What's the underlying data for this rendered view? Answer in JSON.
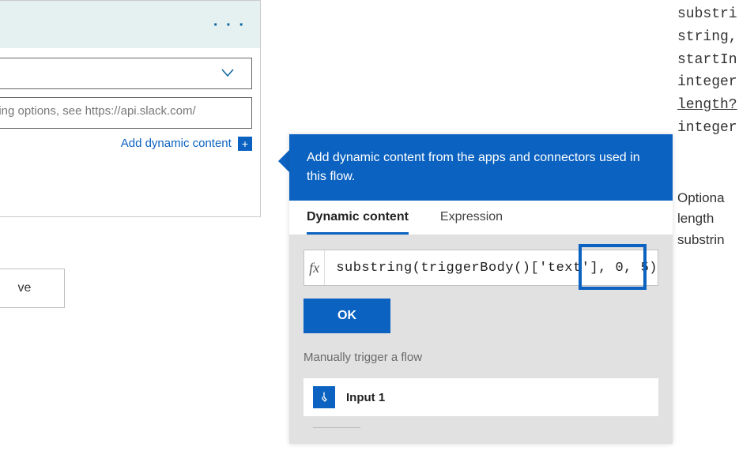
{
  "card": {
    "more_icon": "· · ·",
    "placeholder_text": "tting options, see https://api.slack.com/",
    "add_dynamic_label": "Add dynamic content",
    "plus": "+"
  },
  "save_button": {
    "label": "ve"
  },
  "flyout": {
    "header_text": "Add dynamic content from the apps and connectors used in this flow.",
    "tabs": {
      "dynamic": "Dynamic content",
      "expression": "Expression"
    },
    "fx_label": "fx",
    "expression_value": "substring(triggerBody()['text'], 0, 5)",
    "ok_label": "OK",
    "section_label": "Manually trigger a flow",
    "items": [
      {
        "icon": "touch-icon",
        "label": "Input 1"
      }
    ]
  },
  "doc": {
    "lines": [
      "substri",
      "string,",
      "startIn",
      "integer",
      "length?",
      "integer"
    ],
    "desc": [
      "Optiona",
      "length",
      "substrin"
    ]
  },
  "chart_data": {
    "type": "table",
    "title": "Expression editor parameters (highlighted)",
    "categories": [
      "startIndex",
      "length"
    ],
    "values": [
      0,
      5
    ]
  }
}
